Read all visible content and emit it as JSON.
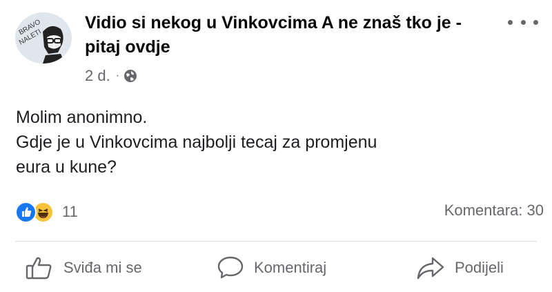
{
  "post": {
    "group_name": "Vidio si nekog u Vinkovcima A ne znaš tko je - pitaj ovdje",
    "avatar_text_1": "BRAVO",
    "avatar_text_2": "NALETI",
    "time": "2 d.",
    "separator": "·",
    "audience_icon": "globe-icon",
    "body_line_1": "Molim anonimno.",
    "body_line_2": "Gdje je u Vinkovcima najbolji tecaj za promjenu",
    "body_line_3": "eura u kune?"
  },
  "stats": {
    "reactions": [
      "like",
      "haha"
    ],
    "reaction_count": "11",
    "comments": "Komentara: 30"
  },
  "actions": {
    "like_label": "Sviđa mi se",
    "comment_label": "Komentiraj",
    "share_label": "Podijeli"
  },
  "colors": {
    "like_blue": "#1877f2",
    "haha_yellow": "#f7c33b",
    "secondary_text": "#65676b"
  }
}
